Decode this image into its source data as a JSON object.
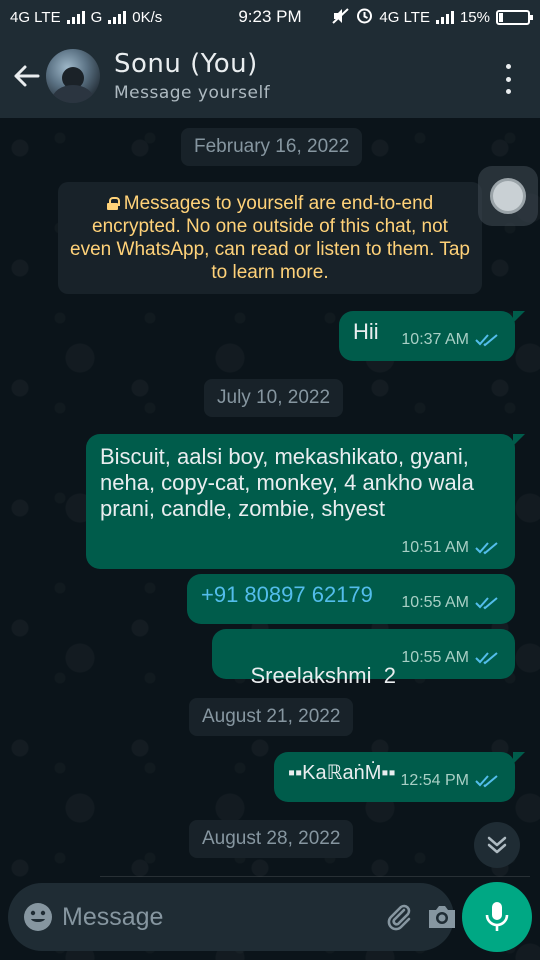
{
  "status_bar": {
    "network1": "4G LTE",
    "network2": "G",
    "speed": "0K/s",
    "time": "9:23 PM",
    "network3": "4G LTE",
    "battery": "15%",
    "battery_level": 0.15
  },
  "header": {
    "name": "Sonu (You)",
    "subtitle": "Message yourself"
  },
  "chat": {
    "encryption_notice": "Messages to yourself are end-to-end encrypted. No one outside of this chat, not even WhatsApp, can read or listen to them. Tap to learn more.",
    "dates": [
      "February 16, 2022",
      "July 10, 2022",
      "August 21, 2022",
      "August 28, 2022"
    ],
    "messages": [
      {
        "text": "Hii",
        "time": "10:37 AM"
      },
      {
        "text": "Biscuit, aalsi boy, mekashikato, gyani, neha, copy-cat, monkey, 4 ankho wala prani, candle, zombie, shyest",
        "time": "10:51 AM"
      },
      {
        "text": "+91 80897 62179",
        "time": "10:55 AM"
      },
      {
        "text": "Sreelakshmi  2",
        "time": "10:55 AM"
      },
      {
        "text": "▪▪KaℝaṅṀ▪▪",
        "time": "12:54 PM"
      }
    ]
  },
  "composer": {
    "placeholder": "Message"
  },
  "colors": {
    "outgoing_bubble": "#005c4b",
    "accent": "#00a884",
    "read_tick": "#53bdeb",
    "notice_text": "#ffd279"
  }
}
